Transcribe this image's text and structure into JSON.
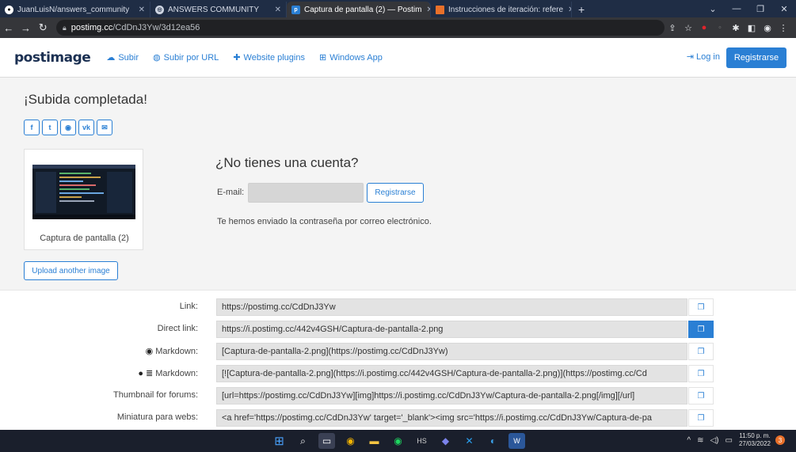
{
  "browser": {
    "tabs": [
      {
        "title": "JuanLuisN/answers_community",
        "icon": "github-icon"
      },
      {
        "title": "ANSWERS COMMUNITY",
        "icon": "chrome-icon"
      },
      {
        "title": "Captura de pantalla (2) — Postim",
        "icon": "postimage-icon"
      },
      {
        "title": "Instrucciones de iteración: refere",
        "icon": "azure-devops-icon"
      }
    ],
    "url_host": "postimg.cc",
    "url_path": "/CdDnJ3Yw/3d12ea56"
  },
  "site_nav": {
    "logo": "postimage",
    "links": [
      {
        "label": "Subir",
        "icon": "cloud-upload-icon"
      },
      {
        "label": "Subir por URL",
        "icon": "globe-icon"
      },
      {
        "label": "Website plugins",
        "icon": "puzzle-icon"
      },
      {
        "label": "Windows App",
        "icon": "windows-icon"
      }
    ],
    "login": "Log in",
    "register": "Registrarse"
  },
  "upload": {
    "heading": "¡Subida completada!",
    "share_icons": [
      "facebook-icon",
      "twitter-icon",
      "reddit-icon",
      "vk-icon",
      "email-icon"
    ],
    "thumbnail_caption": "Captura de pantalla (2)",
    "upload_another": "Upload another image"
  },
  "account": {
    "title": "¿No tienes una cuenta?",
    "email_label": "E-mail:",
    "email_value": "",
    "register_button": "Registrarse",
    "sent_message": "Te hemos enviado la contraseña por correo electrónico."
  },
  "links": [
    {
      "label": "Link:",
      "value": "https://postimg.cc/CdDnJ3Yw"
    },
    {
      "label": "Direct link:",
      "value": "https://i.postimg.cc/442v4GSH/Captura-de-pantalla-2.png"
    },
    {
      "label": "Markdown:",
      "value": "[Captura-de-pantalla-2.png](https://postimg.cc/CdDnJ3Yw)",
      "icon": "reddit-icon"
    },
    {
      "label": "Markdown:",
      "value": "[![Captura-de-pantalla-2.png](https://i.postimg.cc/442v4GSH/Captura-de-pantalla-2.png)](https://postimg.cc/Cd",
      "icon": "github-icon"
    },
    {
      "label": "Thumbnail for forums:",
      "value": "[url=https://postimg.cc/CdDnJ3Yw][img]https://i.postimg.cc/CdDnJ3Yw/Captura-de-pantalla-2.png[/img][/url]"
    },
    {
      "label": "Miniatura para webs:",
      "value": "<a href='https://postimg.cc/CdDnJ3Yw' target='_blank'><img src='https://i.postimg.cc/CdDnJ3Yw/Captura-de-pa"
    }
  ],
  "taskbar": {
    "time": "11:50 p. m.",
    "date": "27/03/2022",
    "notifications": "3"
  },
  "colors": {
    "accent": "#2a7fd4",
    "field_bg": "#e3e3e3",
    "page_bg": "#f4f4f4"
  }
}
